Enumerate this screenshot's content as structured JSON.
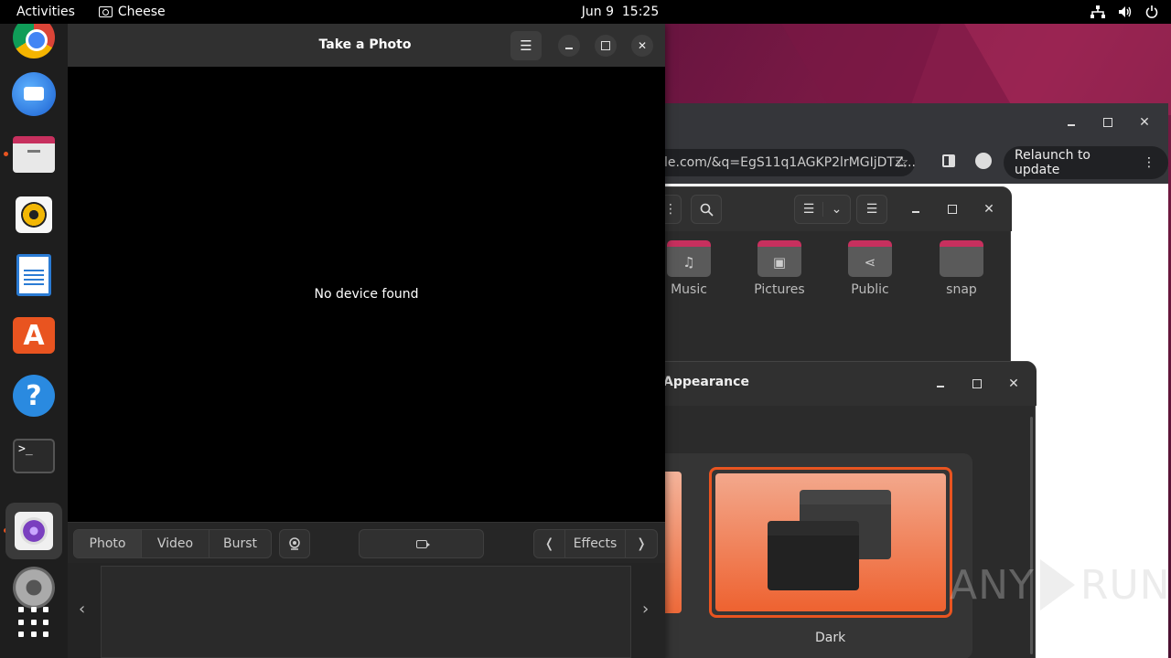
{
  "topbar": {
    "activities": "Activities",
    "app_name": "Cheese",
    "date": "Jun 9",
    "time": "15:25"
  },
  "dock": {
    "items": [
      "chrome",
      "thunderbird",
      "files",
      "rhythmbox",
      "writer",
      "app-center",
      "help",
      "terminal",
      "cheese",
      "settings",
      "show-apps"
    ]
  },
  "chrome": {
    "url_text": "le.com/&q=EgS11q1AGKP2lrMGIjDTZ...",
    "relaunch_label": "Relaunch to update"
  },
  "files": {
    "folders": [
      "Music",
      "Pictures",
      "Public",
      "snap"
    ]
  },
  "appearance": {
    "title": "Appearance",
    "theme_label": "Dark"
  },
  "cheese": {
    "title": "Take a Photo",
    "message": "No device found",
    "modes": [
      "Photo",
      "Video",
      "Burst"
    ],
    "effects_label": "Effects"
  },
  "watermark": {
    "left": "ANY",
    "right": "RUN"
  },
  "colors": {
    "accent": "#e95420",
    "panel": "#242424",
    "topbar": "#000000"
  }
}
